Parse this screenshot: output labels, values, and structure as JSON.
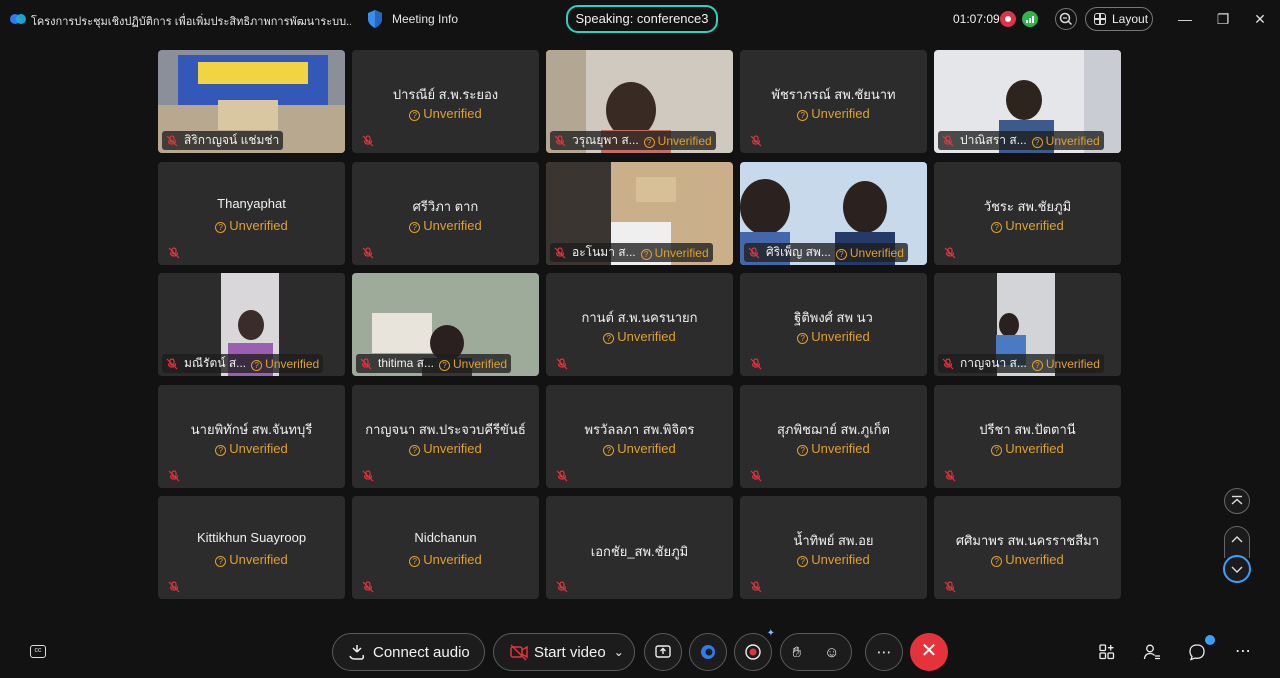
{
  "header": {
    "meeting_title": "โครงการประชุมเชิงปฏิบัติการ เพื่อเพิ่มประสิทธิภาพการพัฒนาระบบ...",
    "meeting_info_label": "Meeting Info",
    "speaking_label": "Speaking: conference3",
    "timer": "01:07:09",
    "layout_label": "Layout"
  },
  "tiles": [
    {
      "name": "สิริกาญจน์ แช่มช่า",
      "video": true,
      "unverified": false
    },
    {
      "name": "ปารณีย์ ส.พ.ระยอง",
      "video": false,
      "unverified": true
    },
    {
      "name": "วรุณยุพา ส...",
      "video": true,
      "unverified": true
    },
    {
      "name": "พัชราภรณ์ สพ.ชัยนาท",
      "video": false,
      "unverified": true
    },
    {
      "name": "ปาณิสรา ส...",
      "video": true,
      "unverified": true
    },
    {
      "name": "Thanyaphat",
      "video": false,
      "unverified": true
    },
    {
      "name": "ศรีวิภา ตาก",
      "video": false,
      "unverified": true
    },
    {
      "name": "อะโนมา ส...",
      "video": true,
      "unverified": true
    },
    {
      "name": "ศิริเพ็ญ สพ...",
      "video": true,
      "unverified": true
    },
    {
      "name": "วัชระ สพ.ชัยภูมิ",
      "video": false,
      "unverified": true
    },
    {
      "name": "มณีรัตน์ ส...",
      "video": true,
      "unverified": true
    },
    {
      "name": "thitima ส...",
      "video": true,
      "unverified": true
    },
    {
      "name": "กานต์ ส.พ.นครนายก",
      "video": false,
      "unverified": true
    },
    {
      "name": "ฐิติพงศ์ สพ นว",
      "video": false,
      "unverified": true
    },
    {
      "name": "กาญจนา ส...",
      "video": true,
      "unverified": true
    },
    {
      "name": "นายพิทักษ์ สพ.จันทบุรี",
      "video": false,
      "unverified": true
    },
    {
      "name": "กาญจนา สพ.ประจวบคีรีขันธ์",
      "video": false,
      "unverified": true
    },
    {
      "name": "พรวัลลภา  สพ.พิจิตร",
      "video": false,
      "unverified": true
    },
    {
      "name": "สุภพิชฌาย์ สพ.ภูเก็ต",
      "video": false,
      "unverified": true
    },
    {
      "name": "ปรีชา สพ.ปัตตานี",
      "video": false,
      "unverified": true
    },
    {
      "name": "Kittikhun Suayroop",
      "video": false,
      "unverified": true
    },
    {
      "name": "Nidchanun",
      "video": false,
      "unverified": true
    },
    {
      "name": "เอกชัย_สพ.ชัยภูมิ",
      "video": false,
      "unverified": false
    },
    {
      "name": "น้ำทิพย์ สพ.อย",
      "video": false,
      "unverified": true
    },
    {
      "name": "ศศิมาพร  สพ.นครราชสีมา",
      "video": false,
      "unverified": true
    }
  ],
  "unverified_label": "Unverified",
  "toolbar": {
    "connect_audio": "Connect audio",
    "start_video": "Start video"
  },
  "colors": {
    "accent_teal": "#2fd1c0",
    "unverified": "#e0a030",
    "leave_red": "#e5333b",
    "tile_bg": "#2c2c2c"
  }
}
